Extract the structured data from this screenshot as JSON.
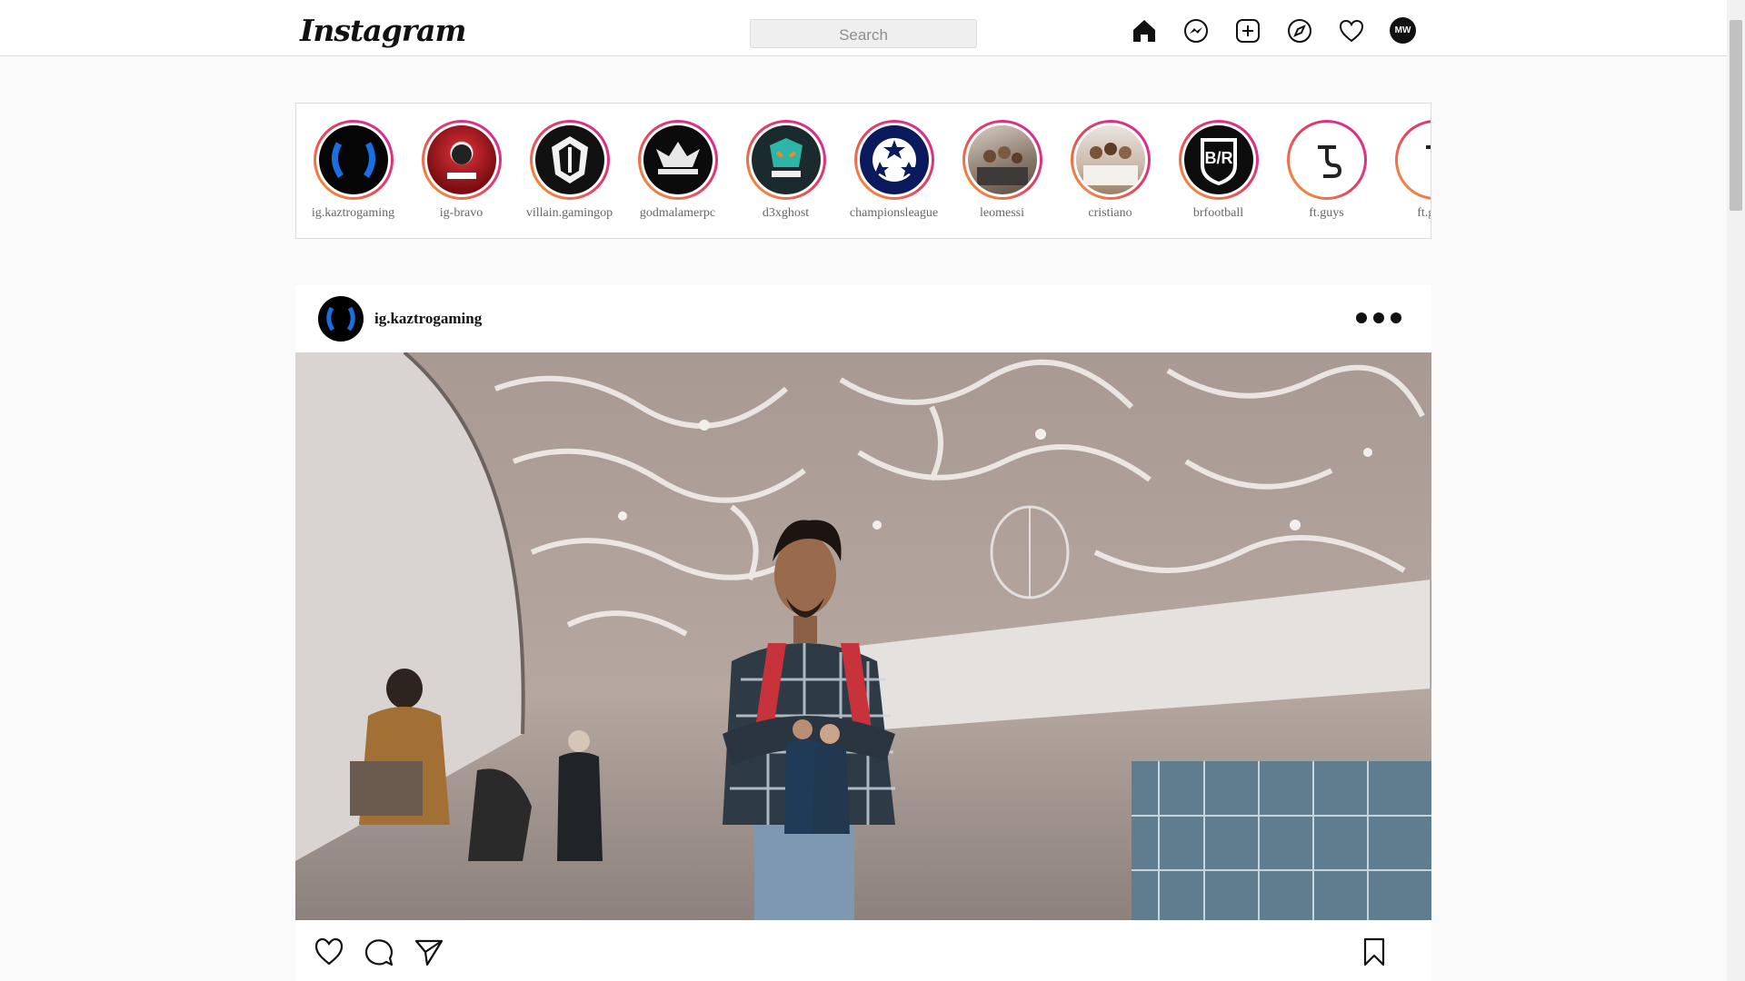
{
  "app": {
    "logo": "Instagram"
  },
  "header": {
    "search_placeholder": "Search",
    "icons": [
      "home-icon",
      "messenger-icon",
      "new-post-icon",
      "explore-icon",
      "activity-heart-icon",
      "profile-avatar"
    ],
    "profile_initials": "MW"
  },
  "stories": [
    {
      "label": "ig.kaztrogaming"
    },
    {
      "label": "ig-bravo"
    },
    {
      "label": "villain.gamingop"
    },
    {
      "label": "godmalamerpc"
    },
    {
      "label": "d3xghost"
    },
    {
      "label": "championsleague"
    },
    {
      "label": "leomessi"
    },
    {
      "label": "cristiano"
    },
    {
      "label": "brfootball"
    },
    {
      "label": "ft.guys"
    },
    {
      "label": "ft.guys"
    }
  ],
  "post": {
    "username": "ig.kaztrogaming",
    "actions": [
      "like-icon",
      "comment-icon",
      "share-icon",
      "save-icon"
    ]
  },
  "colors": {
    "story_ring_start": "#f9a033",
    "story_ring_mid": "#e4405f",
    "story_ring_end": "#d6249f",
    "border": "#dbdbdb",
    "background": "#fafafa"
  }
}
